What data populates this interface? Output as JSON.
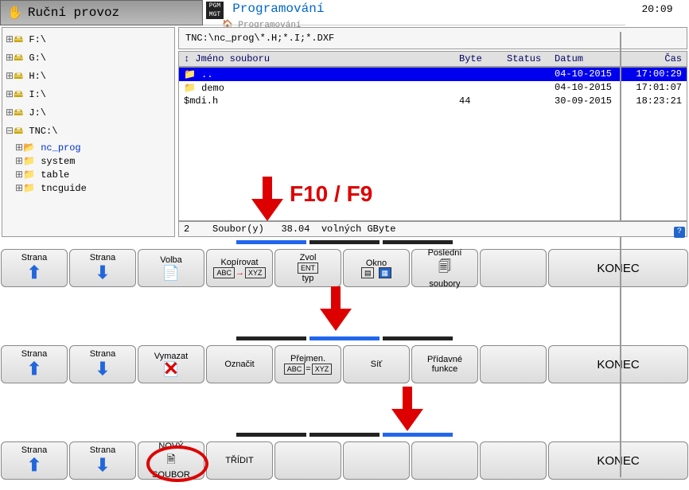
{
  "header": {
    "mode": "Ruční provoz",
    "title": "Programování",
    "subtitle": "Programování",
    "pgm_icon": "PGM\nMGT",
    "time": "20:09"
  },
  "tree": [
    {
      "exp": "⊞",
      "icon": "🖴",
      "label": "F:\\",
      "lvl": 0
    },
    {
      "exp": "⊞",
      "icon": "🖴",
      "label": "G:\\",
      "lvl": 0
    },
    {
      "exp": "⊞",
      "icon": "🖴",
      "label": "H:\\",
      "lvl": 0
    },
    {
      "exp": "⊞",
      "icon": "🖴",
      "label": "I:\\",
      "lvl": 0
    },
    {
      "exp": "⊞",
      "icon": "🖴",
      "label": "J:\\",
      "lvl": 0
    },
    {
      "exp": "⊟",
      "icon": "🖴",
      "label": "TNC:\\",
      "lvl": 0
    },
    {
      "exp": "⊞",
      "icon": "📂",
      "label": "nc_prog",
      "lvl": 1,
      "sel": true
    },
    {
      "exp": "⊞",
      "icon": "📁",
      "label": "system",
      "lvl": 1
    },
    {
      "exp": "⊞",
      "icon": "📁",
      "label": "table",
      "lvl": 1
    },
    {
      "exp": "⊞",
      "icon": "📁",
      "label": "tncguide",
      "lvl": 1
    }
  ],
  "path": "TNC:\\nc_prog\\*.H;*.I;*.DXF",
  "columns": {
    "name": "Jméno souboru",
    "byte": "Byte",
    "status": "Status",
    "date": "Datum",
    "time": "Čas",
    "sort": "↕"
  },
  "files": [
    {
      "icon": "📁",
      "name": "..",
      "byte": "",
      "status": "",
      "date": "04-10-2015",
      "time": "17:00:29",
      "sel": true
    },
    {
      "icon": "📁",
      "name": "demo",
      "byte": "",
      "status": "",
      "date": "04-10-2015",
      "time": "17:01:07"
    },
    {
      "icon": "",
      "name": "$mdi.h",
      "byte": "44",
      "status": "",
      "date": "30-09-2015",
      "time": "18:23:21"
    }
  ],
  "status": {
    "count": "2",
    "label": "Soubor(y)",
    "free": "38.04",
    "unit": "volných GByte"
  },
  "annotation": {
    "text": "F10 / F9"
  },
  "bars": [
    {
      "active_tab": 0,
      "keys": [
        {
          "lbl": "Strana",
          "ic": "up"
        },
        {
          "lbl": "Strana",
          "ic": "down"
        },
        {
          "lbl": "Volba",
          "ic": "page"
        },
        {
          "lbl": "Kopírovat",
          "ic": "copy"
        },
        {
          "lbl": "Zvol",
          "lbl2": "typ",
          "ic": "ent"
        },
        {
          "lbl": "Okno",
          "ic": "win"
        },
        {
          "lbl": "Poslední",
          "lbl2": "soubory",
          "ic": "recent"
        },
        {
          "lbl": "",
          "ic": ""
        }
      ],
      "end": "KONEC"
    },
    {
      "active_tab": 1,
      "keys": [
        {
          "lbl": "Strana",
          "ic": "up"
        },
        {
          "lbl": "Strana",
          "ic": "down"
        },
        {
          "lbl": "Vymazat",
          "ic": "del"
        },
        {
          "lbl": "Označit",
          "ic": ""
        },
        {
          "lbl": "Přejmen.",
          "ic": "ren"
        },
        {
          "lbl": "Síť",
          "ic": ""
        },
        {
          "lbl": "Přídavné",
          "lbl2": "funkce",
          "ic": ""
        },
        {
          "lbl": "",
          "ic": ""
        }
      ],
      "end": "KONEC"
    },
    {
      "active_tab": 2,
      "keys": [
        {
          "lbl": "Strana",
          "ic": "up"
        },
        {
          "lbl": "Strana",
          "ic": "down"
        },
        {
          "lbl": "NOVÝ",
          "lbl2": "SOUBOR",
          "ic": "new"
        },
        {
          "lbl": "TŘÍDIT",
          "ic": ""
        },
        {
          "lbl": "",
          "ic": ""
        },
        {
          "lbl": "",
          "ic": ""
        },
        {
          "lbl": "",
          "ic": ""
        },
        {
          "lbl": "",
          "ic": ""
        }
      ],
      "end": "KONEC"
    }
  ]
}
